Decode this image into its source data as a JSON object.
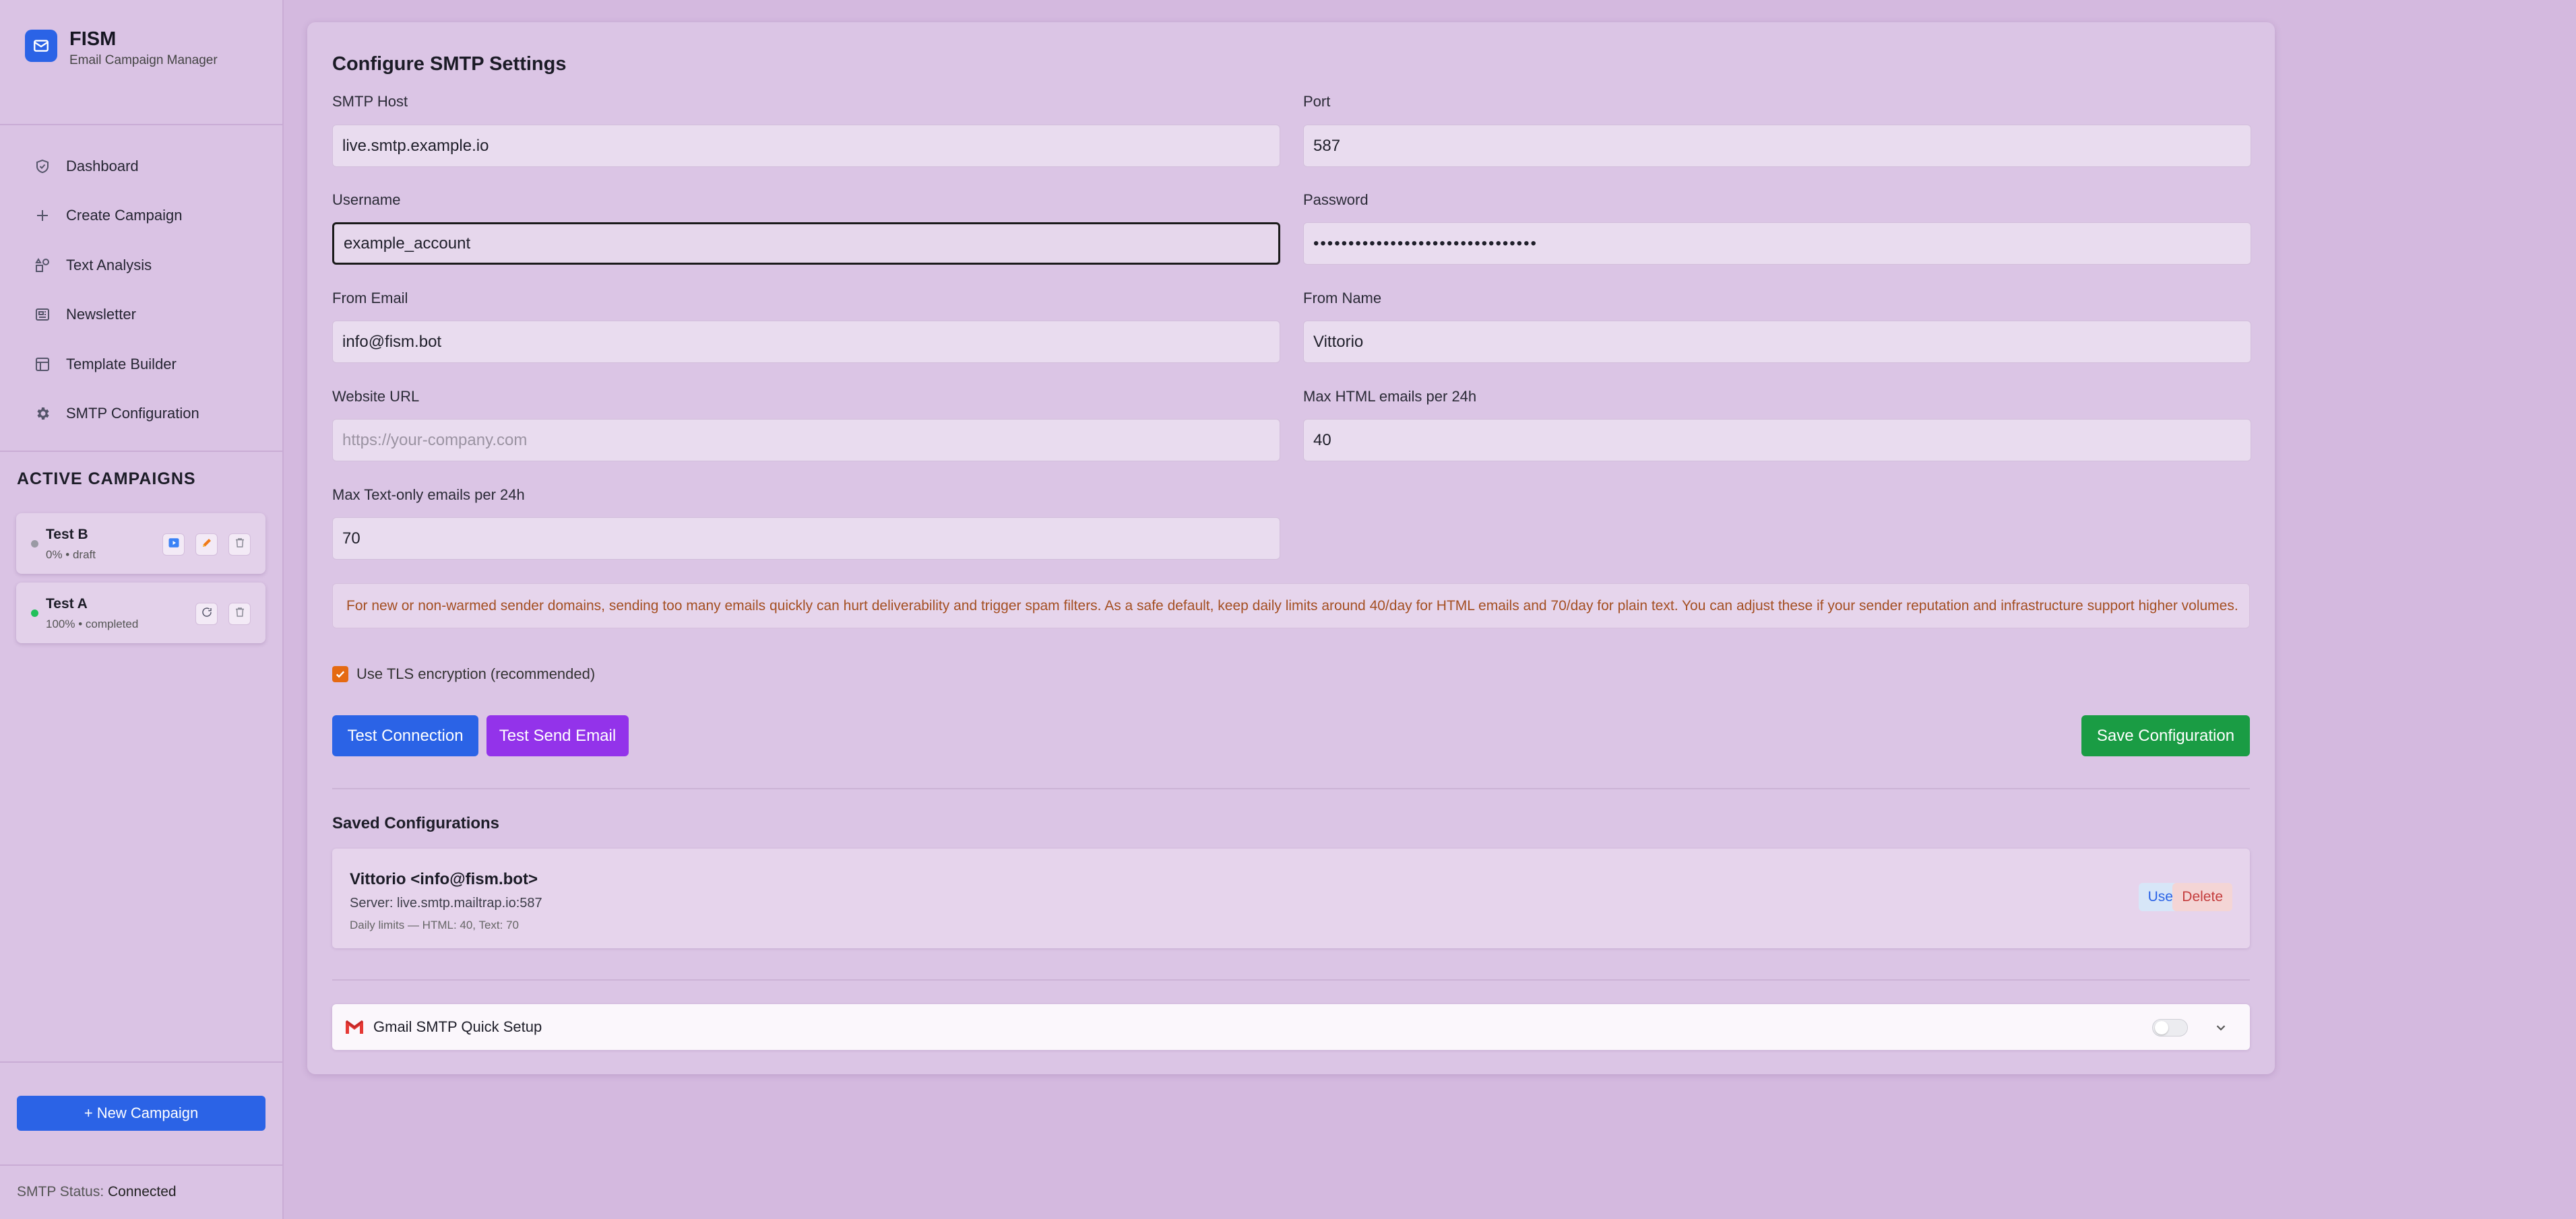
{
  "brand": {
    "name": "FISM",
    "subtitle": "Email Campaign Manager"
  },
  "nav": [
    {
      "label": "Dashboard",
      "icon": "shield-check-icon"
    },
    {
      "label": "Create Campaign",
      "icon": "plus-icon"
    },
    {
      "label": "Text Analysis",
      "icon": "shapes-icon"
    },
    {
      "label": "Newsletter",
      "icon": "newspaper-icon"
    },
    {
      "label": "Template Builder",
      "icon": "layout-icon"
    },
    {
      "label": "SMTP Configuration",
      "icon": "gear-icon"
    }
  ],
  "campaigns": {
    "title": "ACTIVE CAMPAIGNS",
    "items": [
      {
        "name": "Test B",
        "meta": "0% • draft",
        "status_color": "#9a9aa4"
      },
      {
        "name": "Test A",
        "meta": "100% • completed",
        "status_color": "#22c05a"
      }
    ]
  },
  "new_campaign_label": "+ New Campaign",
  "smtp_status": {
    "label": "SMTP Status:",
    "value": "Connected"
  },
  "form": {
    "title": "Configure SMTP Settings",
    "host": {
      "label": "SMTP Host",
      "value": "live.smtp.example.io"
    },
    "port": {
      "label": "Port",
      "value": "587"
    },
    "username": {
      "label": "Username",
      "value": "example_account"
    },
    "password": {
      "label": "Password",
      "value": "••••••••••••••••••••••••••••••••"
    },
    "from_email": {
      "label": "From Email",
      "value": "info@fism.bot"
    },
    "from_name": {
      "label": "From Name",
      "value": "Vittorio"
    },
    "website": {
      "label": "Website URL",
      "value": "",
      "placeholder": "https://your-company.com"
    },
    "max_html": {
      "label": "Max HTML emails per 24h",
      "value": "40"
    },
    "max_text": {
      "label": "Max Text-only emails per 24h",
      "value": "70"
    },
    "notice": "For new or non-warmed sender domains, sending too many emails quickly can hurt deliverability and trigger spam filters. As a safe default, keep daily limits around 40/day for HTML emails and 70/day for plain text. You can adjust these if your sender reputation and infrastructure support higher volumes.",
    "tls_label": "Use TLS encryption (recommended)"
  },
  "buttons": {
    "test_connection": "Test Connection",
    "test_send": "Test Send Email",
    "save": "Save Configuration"
  },
  "saved": {
    "title": "Saved Configurations",
    "item": {
      "name": "Vittorio <info@fism.bot>",
      "server": "Server: live.smtp.mailtrap.io:587",
      "limits": "Daily limits — HTML: 40, Text: 70",
      "use_label": "Use",
      "delete_label": "Delete"
    }
  },
  "gmail": {
    "label": "Gmail SMTP Quick Setup"
  },
  "colors": {
    "primary": "#2b63e6",
    "purple": "#9333ea",
    "success": "#1a9c44",
    "warning_text": "#a44f22"
  }
}
